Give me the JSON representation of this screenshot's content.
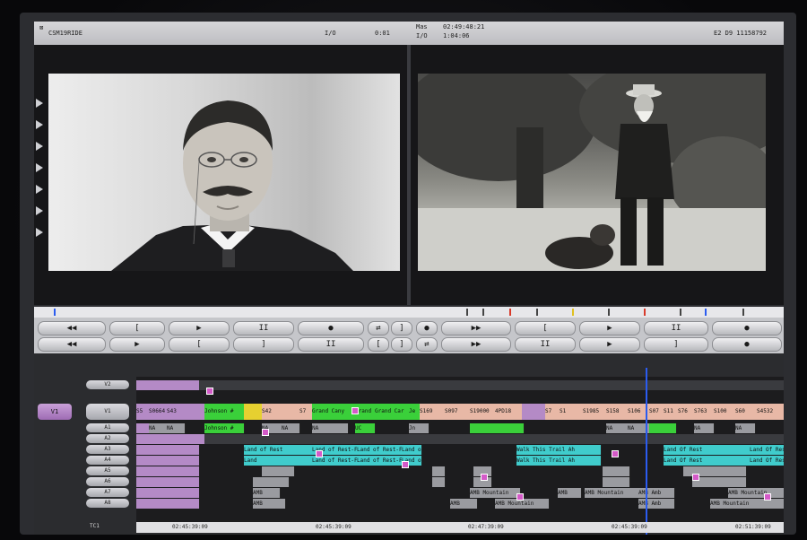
{
  "infobar": {
    "left_label": "CSM19RIDE",
    "io_left": "I/O",
    "time_left": "0:01",
    "mas_label": "Mas",
    "timecode_top": "02:49:48:21",
    "io_right": "I/O",
    "time_right": "1:04:06",
    "right_label": "E2 D9 11158792"
  },
  "monitors": {
    "source_label": "source-monitor",
    "record_label": "record-monitor"
  },
  "transport": {
    "stop_glyph": "II",
    "play_glyph": "▶",
    "rew_glyph": "◀◀",
    "ff_glyph": "▶▶",
    "mark_glyph": "●",
    "splice_glyph": "⇄",
    "in_glyph": "[",
    "out_glyph": "]"
  },
  "timeline": {
    "v1_selector": "V1",
    "tracks": [
      "V2",
      "V1",
      "A1",
      "A2",
      "A3",
      "A4",
      "A5",
      "A6",
      "A7",
      "A8"
    ],
    "timecode_label": "TC1",
    "ruler": [
      "02:45:39:09",
      "02:45:39:09",
      "02:47:39:09",
      "02:45:39:09",
      "02:51:39:09"
    ],
    "v1_clips": [
      "S5",
      "S0664",
      "S43",
      "Johnson #",
      "S42",
      "S7",
      "Grand Cany",
      "Grand",
      "Grand Car",
      "Je",
      "S169",
      "S097",
      "S19000",
      "4PD18",
      "S7",
      "S1",
      "S1985",
      "S158",
      "S106",
      "S07",
      "S11",
      "S76",
      "S763",
      "S100",
      "S60",
      "S4532"
    ],
    "a1_clips": [
      "NA",
      "NA",
      "Johnson #",
      "NA",
      "NA",
      "NA",
      "UC",
      "Jn",
      "NA",
      "NA",
      "NA",
      "NA"
    ],
    "a3_clips": [
      "Land of Rest",
      "Land of Rest-F",
      "Land of Rest-F",
      "Land of Lor",
      "Walk This Trail Ah",
      "Land Of Rest",
      "Land Of Rest"
    ],
    "a4_clips": [
      "Land",
      "Land of Rest-F",
      "Land of Rest-F",
      "Land of",
      "Walk This Trail Ah",
      "Land Of Rest",
      "Land Of Rest"
    ],
    "a7_clips": [
      "AMB",
      "AMB Mountain",
      "AMB",
      "AMB Mountain",
      "AMB Amb",
      "AMB Mountain"
    ],
    "a8_clips": [
      "AMB",
      "AMB",
      "AMB Mountain",
      "AMB Amb",
      "AMB Mountain"
    ]
  }
}
